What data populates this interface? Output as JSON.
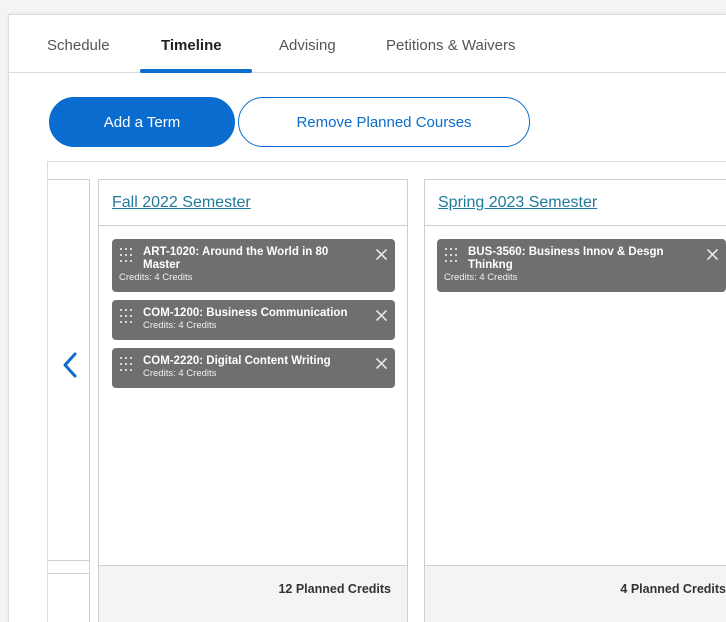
{
  "tabs": [
    {
      "label": "Schedule",
      "active": false
    },
    {
      "label": "Timeline",
      "active": true
    },
    {
      "label": "Advising",
      "active": false
    },
    {
      "label": "Petitions & Waivers",
      "active": false
    }
  ],
  "buttons": {
    "add_term": "Add a Term",
    "remove_planned": "Remove Planned Courses"
  },
  "navigation": {
    "prev_icon": "chevron-left-icon"
  },
  "terms": [
    {
      "title": "Fall 2022 Semester",
      "courses": [
        {
          "title": "ART-1020: Around the World in 80 Master",
          "credits": "Credits: 4 Credits"
        },
        {
          "title": "COM-1200: Business Communication",
          "credits": "Credits: 4 Credits"
        },
        {
          "title": "COM-2220: Digital Content Writing",
          "credits": "Credits: 4 Credits"
        }
      ],
      "footer": "12 Planned Credits"
    },
    {
      "title": "Spring 2023 Semester",
      "courses": [
        {
          "title": "BUS-3560: Business Innov & Desgn Thinkng",
          "credits": "Credits: 4 Credits"
        }
      ],
      "footer": "4 Planned Credits"
    }
  ],
  "colors": {
    "accent": "#0a6ccf",
    "term_link": "#1f7a9c",
    "course_bg": "#6f6f6f"
  }
}
